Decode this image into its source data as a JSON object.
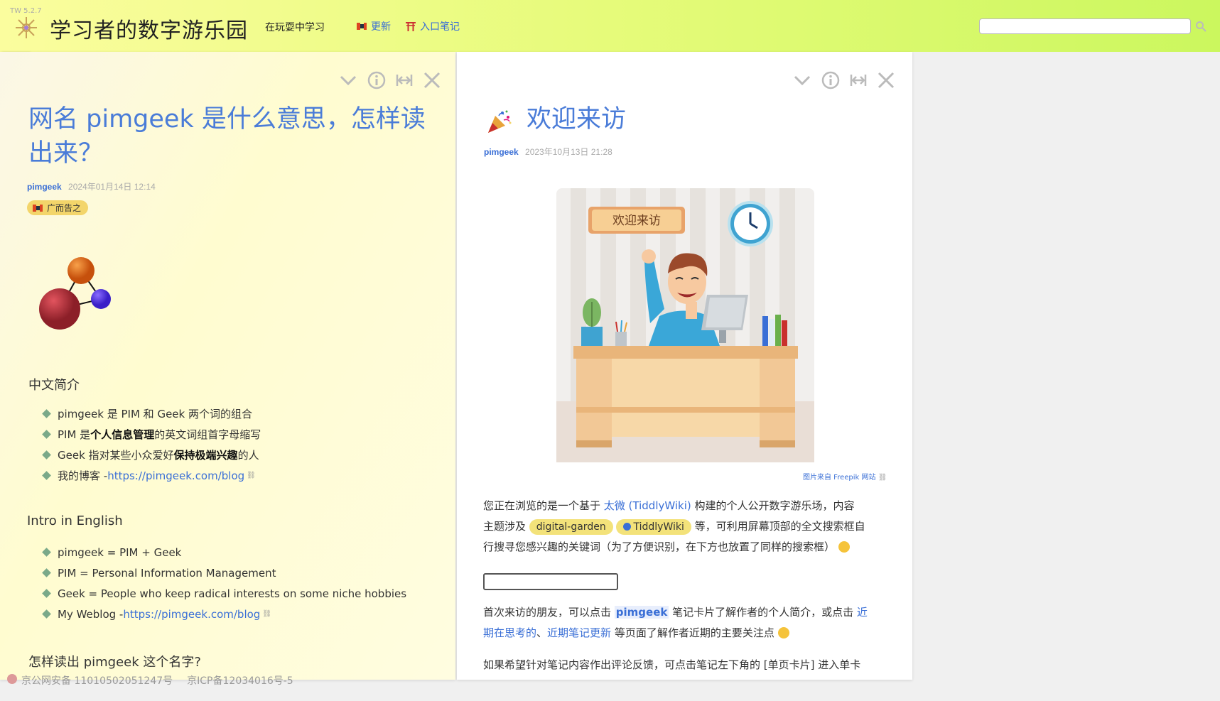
{
  "topbar": {
    "version": "TW 5.2.7",
    "title": "学习者的数字游乐园",
    "subtitle": "在玩耍中学习",
    "links": [
      {
        "label": "更新",
        "icon": "flag-icon"
      },
      {
        "label": "入口笔记",
        "icon": "torii-gate-icon"
      }
    ],
    "search_placeholder": ""
  },
  "left_tiddler": {
    "title": "网名 pimgeek 是什么意思，怎样读出来？",
    "title_line1": "网名 pimgeek 是什么意思，怎样读",
    "title_line2": "出来？",
    "author": "pimgeek",
    "date": "2024年01月14日 12:14",
    "tag": "广而告之",
    "section_cn": {
      "heading": "中文简介",
      "items": [
        {
          "pre": "pimgeek 是 PIM 和 Geek 两个词的组合",
          "bold": "",
          "post": ""
        },
        {
          "pre": "PIM 是",
          "bold": "个人信息管理",
          "post": "的英文词组首字母缩写"
        },
        {
          "pre": "Geek 指对某些小众爱好",
          "bold": "保持极端兴趣",
          "post": "的人"
        },
        {
          "pre": "我的博客 - ",
          "link": "https://pimgeek.com/blog"
        }
      ]
    },
    "section_en": {
      "heading": "Intro in English",
      "items": [
        {
          "text": "pimgeek = PIM + Geek"
        },
        {
          "text": "PIM = Personal Information Management"
        },
        {
          "text": "Geek = People who keep radical interests on some niche hobbies"
        },
        {
          "pre": "My Weblog - ",
          "link": "https://pimgeek.com/blog"
        }
      ]
    },
    "section_read": {
      "heading": "怎样读出 pimgeek 这个名字?"
    }
  },
  "right_tiddler": {
    "title": "欢迎来访",
    "author": "pimgeek",
    "date": "2023年10月13日 21:28",
    "illustration_sign": "欢迎来访",
    "caption": "图片来自 Freepik 网站",
    "para1": {
      "t1": "您正在浏览的是一个基于 ",
      "link": "太微 (TiddlyWiki)",
      "t2": " 构建的个人公开数字游乐场，内容",
      "t3": "主题涉及 ",
      "tag1": "digital-garden",
      "tag2": "TiddlyWiki",
      "t4": " 等，可利用屏幕顶部的全文搜索框自",
      "t5": "行搜寻您感兴趣的关键词（为了方便识别，在下方也放置了同样的搜索框）"
    },
    "para2": {
      "t1": "首次来访的朋友，可以点击 ",
      "hl": "pimgeek",
      "t2": " 笔记卡片了解作者的个人简介，或点击 ",
      "link1a": "近",
      "link1b": "期在思考的",
      "sep": "、",
      "link2": "近期笔记更新",
      "t3": " 等页面了解作者近期的主要关注点 "
    },
    "para3": "如果希望针对笔记内容作出评论反馈，可点击笔记左下角的 [单页卡片] 进入单卡"
  },
  "footer": {
    "police": "京公网安备 11010502051247号",
    "icp": "京ICP备12034016号-5"
  }
}
